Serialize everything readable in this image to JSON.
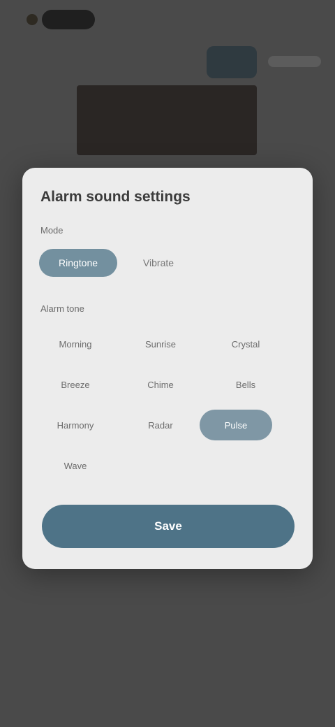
{
  "dialog": {
    "title": "Alarm sound settings",
    "mode_label": "Mode",
    "mode_options": [
      "Ringtone",
      "Vibrate"
    ],
    "mode_selected": "Ringtone",
    "tone_label": "Alarm tone",
    "tones": [
      "Morning",
      "Sunrise",
      "Crystal",
      "Breeze",
      "Chime",
      "Bells",
      "Harmony",
      "Radar",
      "Pulse",
      "Wave"
    ],
    "tone_selected": "Pulse",
    "confirm_label": "Save"
  },
  "colors": {
    "accent": "#4e7387",
    "chip_selected": "#7f97a5",
    "scrim": "#4a4a4a",
    "dialog_bg": "#ececec"
  }
}
